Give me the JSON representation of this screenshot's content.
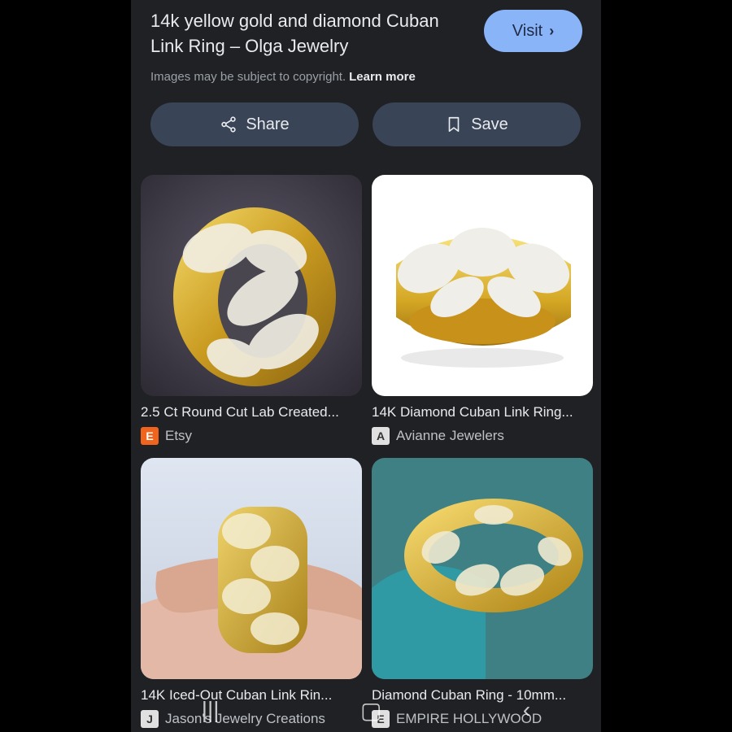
{
  "header": {
    "title": "14k yellow gold and diamond Cuban Link Ring – Olga Jewelry",
    "copyright_text": "Images may be subject to copyright.",
    "learn_more_label": "Learn more",
    "visit_label": "Visit"
  },
  "actions": {
    "share_label": "Share",
    "save_label": "Save"
  },
  "results": [
    {
      "caption": "2.5 Ct Round Cut Lab Created...",
      "source": "Etsy",
      "favicon": "E",
      "icon": "etsy-favicon-icon"
    },
    {
      "caption": "14K Diamond Cuban Link Ring...",
      "source": "Avianne Jewelers",
      "favicon": "A",
      "icon": "avianne-favicon-icon"
    },
    {
      "caption": "14K Iced-Out Cuban Link Rin...",
      "source": "Jason's Jewelry Creations",
      "favicon": "J",
      "icon": "jasons-favicon-icon"
    },
    {
      "caption": "Diamond Cuban Ring - 10mm...",
      "source": "EMPIRE HOLLYWOOD",
      "favicon": "E",
      "icon": "empire-favicon-icon"
    }
  ],
  "colors": {
    "background": "#202124",
    "visit_button": "#8ab4f8",
    "action_button": "#394457",
    "etsy": "#f1641e"
  },
  "navbar": {
    "recents_icon": "recent-apps-icon",
    "home_icon": "home-icon",
    "back_icon": "back-icon"
  }
}
